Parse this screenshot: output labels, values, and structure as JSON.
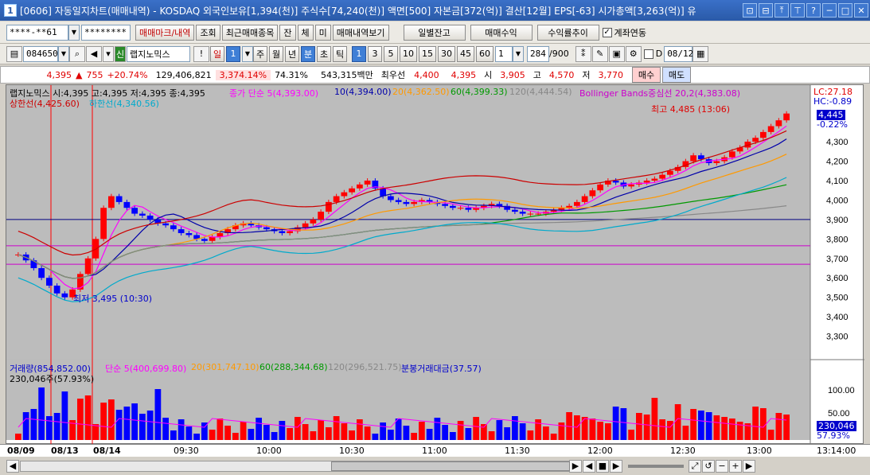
{
  "window": {
    "number": "1",
    "title": "[0606] 자동일지차트(매매내역) - KOSDAQ 외국인보유[1,394(천)] 주식수[74,240(천)] 액면[500] 자본금[372(억)] 결산[12월] EPS[-63] 시가총액[3,263(억)] 유",
    "buttons": [
      "⊡",
      "⊟",
      "⤒",
      "⊤",
      "?",
      "─",
      "□",
      "✕"
    ]
  },
  "toolbar1": {
    "account": "****-**61",
    "password": "********",
    "btn_mark": "매매마크/내역",
    "btn_query": "조회",
    "btn_recent": "최근매매종목",
    "btn_jan": "잔",
    "btn_che": "체",
    "btn_mi": "미",
    "btn_history": "매매내역보기",
    "btn_daily": "일별잔고",
    "btn_profit": "매매수익",
    "btn_rate": "수익률추이",
    "link_label": "계좌연동",
    "link_checked": "✓"
  },
  "toolbar2": {
    "code": "084650",
    "stock_name": "랩지노믹스",
    "period": "일",
    "period_num": "1",
    "units": [
      "주",
      "월",
      "년",
      "분",
      "초",
      "틱"
    ],
    "minutes": [
      "1",
      "3",
      "5",
      "10",
      "15",
      "30",
      "45",
      "60"
    ],
    "step": "1",
    "count": "284",
    "count_total": "/900",
    "d_label": "D",
    "date": "08/12"
  },
  "quote": {
    "price": "4,395",
    "change": "755",
    "change_pct": "+20.74%",
    "volume": "129,406,821",
    "vol_ratio": "3,374.14%",
    "turnover": "74.31%",
    "amount": "543,315백만",
    "best_label": "최우선",
    "best_ask": "4,400",
    "best_bid": "4,395",
    "open_label": "시",
    "open": "3,905",
    "high_label": "고",
    "high": "4,570",
    "low_label": "저",
    "low": "3,770",
    "buy": "매수",
    "sell": "매도"
  },
  "legend": {
    "price": "랩지노믹스 시:4,395 고:4,395 저:4,395 종:4,395",
    "ma5": "종가 단순 5(4,393.00)",
    "ma10": "10(4,394.00)",
    "ma20": "20(4,362.50)",
    "ma60": "60(4,399.33)",
    "ma120": "120(4,444.54)",
    "bb": "Bollinger Bands중심선 20,2(4,383.08)",
    "upper": "상한선(4,425.60)",
    "lower": "하한선(4,340.56)",
    "lc": "LC:27.18",
    "hc": "HC:-0.89",
    "vol": "거래량(854,852.00)",
    "vma5": "단순 5(400,699.80)",
    "vma20": "20(301,747.10)",
    "vma60": "60(288,344.68)",
    "vma120": "120(296,521.75)",
    "amount": "분봉거래대금(37.57)",
    "vol_cur": "230,046주(57.93%)"
  },
  "annotations": {
    "high": "최고 4,485 (13:06)",
    "low": "최저 3,495 (10:30)"
  },
  "price_axis": [
    "4,300",
    "4,200",
    "4,100",
    "4,000",
    "3,900",
    "3,800",
    "3,700",
    "3,600",
    "3,500",
    "3,400",
    "3,300"
  ],
  "price_tag": {
    "value": "4,445",
    "pct": "-0.22%"
  },
  "vol_axis": [
    "100.00",
    "50.00"
  ],
  "vol_tag": {
    "value": "230,046",
    "pct": "57.93%"
  },
  "time_axis": [
    "08/09",
    "08/13",
    "08/14",
    "09:30",
    "10:00",
    "10:30",
    "11:00",
    "11:30",
    "12:00",
    "12:30",
    "13:00",
    "13:14:00"
  ],
  "chart_data": {
    "type": "candlestick",
    "series_close": [
      3720,
      3690,
      3650,
      3600,
      3560,
      3520,
      3500,
      3540,
      3620,
      3700,
      3800,
      3960,
      4020,
      3990,
      3960,
      3930,
      3920,
      3900,
      3880,
      3870,
      3850,
      3830,
      3820,
      3800,
      3790,
      3810,
      3830,
      3850,
      3870,
      3880,
      3870,
      3860,
      3850,
      3840,
      3830,
      3840,
      3860,
      3880,
      3900,
      3940,
      3990,
      4020,
      4040,
      4060,
      4080,
      4100,
      4060,
      4020,
      4000,
      3990,
      3980,
      3990,
      4000,
      3990,
      3980,
      3970,
      3960,
      3960,
      3950,
      3960,
      3970,
      3980,
      3970,
      3950,
      3940,
      3930,
      3930,
      3930,
      3940,
      3950,
      3960,
      3970,
      3990,
      4020,
      4050,
      4080,
      4100,
      4090,
      4070,
      4080,
      4090,
      4100,
      4110,
      4130,
      4150,
      4170,
      4200,
      4230,
      4210,
      4190,
      4200,
      4220,
      4250,
      4270,
      4300,
      4320,
      4350,
      4380,
      4410,
      4445
    ]
  },
  "colors": {
    "up": "#ff0000",
    "down": "#0000ff",
    "ma5": "#ff00ff",
    "ma10": "#0000aa",
    "ma20": "#ff9900",
    "ma60": "#009900",
    "ma120": "#888888",
    "bb": "#cc0000",
    "lower": "#00aacc",
    "accent": "#2a5aa8"
  }
}
